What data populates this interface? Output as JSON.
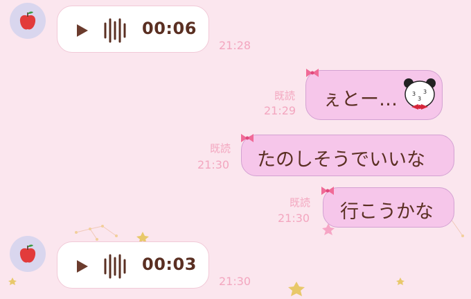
{
  "messages": [
    {
      "type": "voice",
      "side": "left",
      "duration": "00:06",
      "time": "21:28"
    },
    {
      "type": "text",
      "side": "right",
      "text": "ぇとー…",
      "sticker": "panda-sticker",
      "read": "既読",
      "time": "21:29"
    },
    {
      "type": "text",
      "side": "right",
      "text": "たのしそうでいいな",
      "read": "既読",
      "time": "21:30"
    },
    {
      "type": "text",
      "side": "right",
      "text": "行こうかな",
      "read": "既読",
      "time": "21:30"
    },
    {
      "type": "voice",
      "side": "left",
      "duration": "00:03",
      "time": "21:30"
    }
  ],
  "colors": {
    "background": "#fbe6ee",
    "bubble_pink": "#f6c6ea",
    "bubble_white": "#ffffff",
    "text_brown": "#5a2f22",
    "meta_pink": "#f3a6bf",
    "bow": "#f06a97",
    "star": "#e8c86a"
  },
  "icons": {
    "avatar": "apple-icon",
    "voice": "play-icon",
    "waveform": "waveform-icon",
    "decor": "star-icon"
  }
}
